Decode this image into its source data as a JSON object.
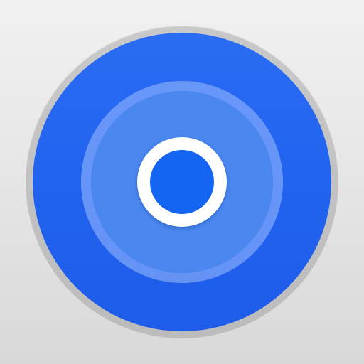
{
  "app_icon": {
    "icon_name": "find-devices-target-icon",
    "colors": {
      "background": "#e6e6e6",
      "rim": "#c4c4c4",
      "disc_blue": "#2466f0",
      "halo_ring": "#8fb2f7",
      "inner_disc": "#4a88ef",
      "dot_outline": "#ffffff",
      "dot_core": "#1565f3"
    }
  }
}
